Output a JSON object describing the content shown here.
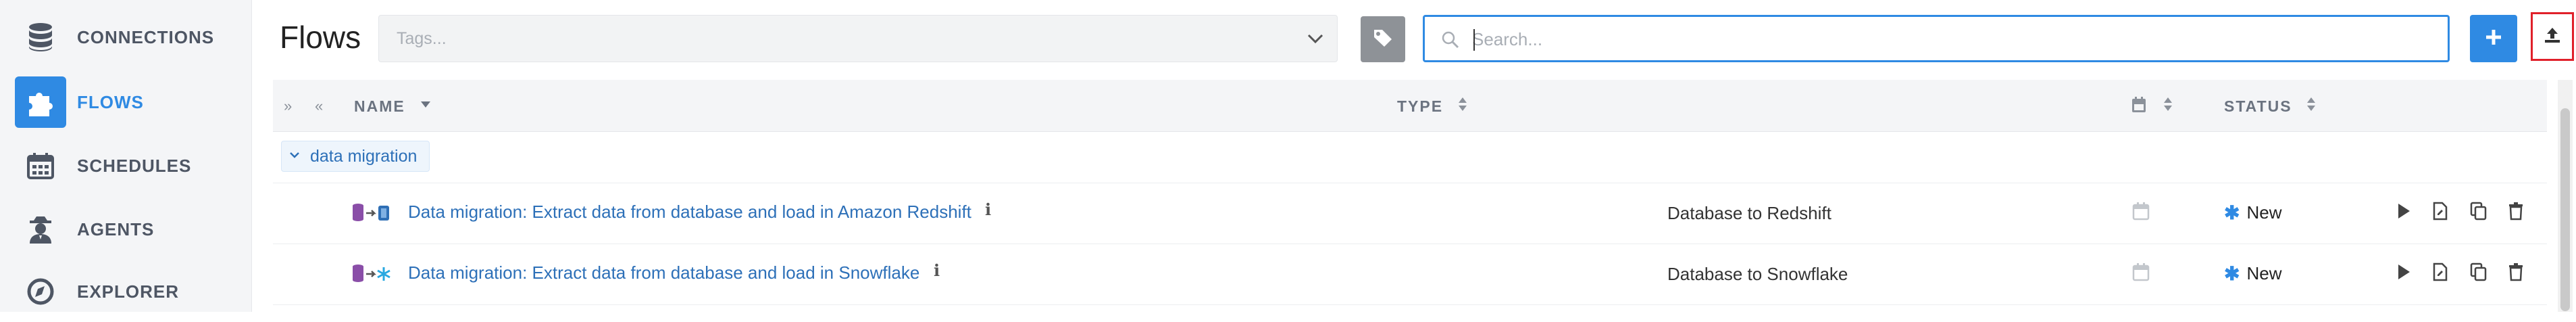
{
  "sidebar": {
    "items": [
      {
        "label": "CONNECTIONS",
        "icon": "database-icon",
        "active": false
      },
      {
        "label": "FLOWS",
        "icon": "puzzle-icon",
        "active": true
      },
      {
        "label": "SCHEDULES",
        "icon": "calendar-icon",
        "active": false
      },
      {
        "label": "AGENTS",
        "icon": "agent-icon",
        "active": false
      },
      {
        "label": "EXPLORER",
        "icon": "compass-icon",
        "active": false
      }
    ]
  },
  "header": {
    "title": "Flows",
    "tags_placeholder": "Tags...",
    "search_placeholder": "Search..."
  },
  "table": {
    "columns": {
      "name": "NAME",
      "type": "TYPE",
      "status": "STATUS"
    },
    "groups": [
      {
        "label": "data migration",
        "rows": [
          {
            "name": "Data migration: Extract data from database and load in Amazon Redshift",
            "type": "Database to Redshift",
            "status": "New"
          },
          {
            "name": "Data migration: Extract data from database and load in Snowflake",
            "type": "Database to Snowflake",
            "status": "New"
          }
        ]
      }
    ]
  },
  "colors": {
    "accent": "#2f8ae3",
    "highlight_border": "#e0202a",
    "sidebar_bg": "#f4f5f7"
  }
}
